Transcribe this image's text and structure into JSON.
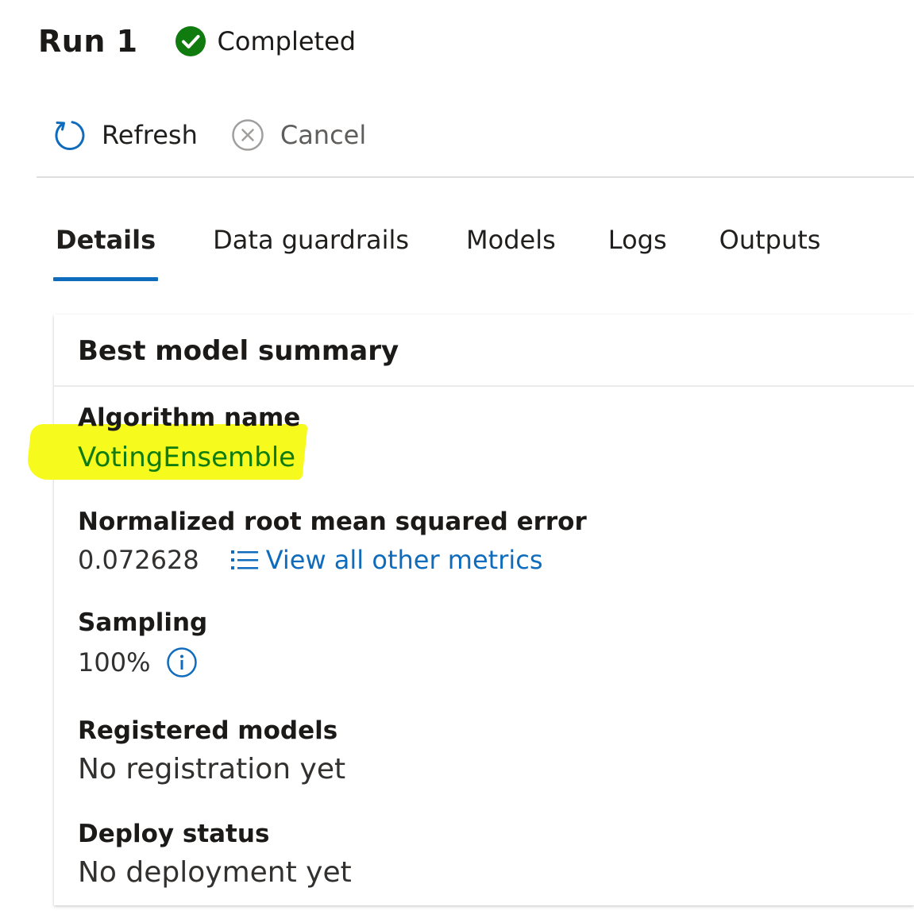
{
  "header": {
    "run_title": "Run 1",
    "status_text": "Completed",
    "status_icon": "check-circle-icon",
    "status_color": "#107c10"
  },
  "toolbar": {
    "refresh_label": "Refresh",
    "refresh_icon": "refresh-icon",
    "cancel_label": "Cancel",
    "cancel_icon": "dismiss-circle-icon"
  },
  "tabs": [
    {
      "label": "Details",
      "active": true
    },
    {
      "label": "Data guardrails",
      "active": false
    },
    {
      "label": "Models",
      "active": false
    },
    {
      "label": "Logs",
      "active": false
    },
    {
      "label": "Outputs",
      "active": false
    }
  ],
  "summary": {
    "title": "Best model summary",
    "algorithm": {
      "label": "Algorithm name",
      "value": "VotingEnsemble",
      "highlight_color": "#f7fa1d"
    },
    "metric": {
      "label": "Normalized root mean squared error",
      "value": "0.072628",
      "link_label": "View all other metrics",
      "link_icon": "list-icon"
    },
    "sampling": {
      "label": "Sampling",
      "value": "100%",
      "info_icon": "info-icon"
    },
    "registered": {
      "label": "Registered models",
      "value": "No registration yet"
    },
    "deploy": {
      "label": "Deploy status",
      "value": "No deployment yet"
    }
  },
  "colors": {
    "accent": "#0f6cbd",
    "success": "#107c10"
  }
}
